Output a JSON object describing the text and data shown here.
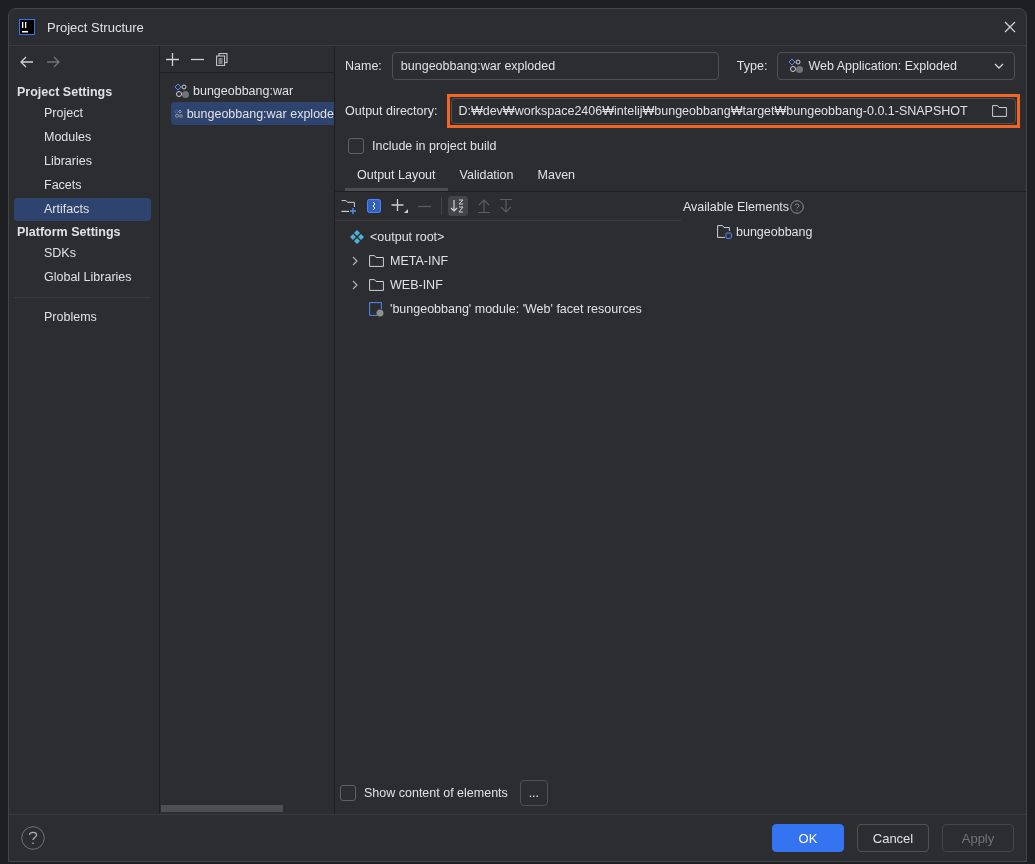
{
  "window": {
    "title": "Project Structure"
  },
  "nav": {
    "sections": [
      {
        "title": "Project Settings",
        "items": [
          {
            "label": "Project",
            "selected": false
          },
          {
            "label": "Modules",
            "selected": false
          },
          {
            "label": "Libraries",
            "selected": false
          },
          {
            "label": "Facets",
            "selected": false
          },
          {
            "label": "Artifacts",
            "selected": true
          }
        ]
      },
      {
        "title": "Platform Settings",
        "items": [
          {
            "label": "SDKs",
            "selected": false
          },
          {
            "label": "Global Libraries",
            "selected": false
          }
        ]
      }
    ],
    "extra_items": [
      {
        "label": "Problems",
        "selected": false
      }
    ]
  },
  "artifacts": [
    {
      "label": "bungeobbang:war",
      "selected": false
    },
    {
      "label": "bungeobbang:war explode",
      "selected": true
    }
  ],
  "name_field": {
    "label": "Name:",
    "value": "bungeobbang:war exploded"
  },
  "type_field": {
    "label": "Type:",
    "value": "Web Application: Exploded"
  },
  "output_directory": {
    "label": "Output directory:",
    "value": "D:₩dev₩workspace2406₩intelij₩bungeobbang₩target₩bungeobbang-0.0.1-SNAPSHOT"
  },
  "include_in_build": {
    "label": "Include in project build",
    "checked": false
  },
  "tabs": [
    {
      "label": "Output Layout",
      "selected": true
    },
    {
      "label": "Validation",
      "selected": false
    },
    {
      "label": "Maven",
      "selected": false
    }
  ],
  "layout_tree": [
    {
      "label": "<output root>",
      "kind": "root",
      "children": [
        {
          "label": "META-INF",
          "kind": "folder",
          "expanded": false
        },
        {
          "label": "WEB-INF",
          "kind": "folder",
          "expanded": false
        },
        {
          "label": "'bungeobbang' module: 'Web' facet resources",
          "kind": "resource"
        }
      ]
    }
  ],
  "available_elements": {
    "title": "Available Elements",
    "items": [
      {
        "label": "bungeobbang"
      }
    ]
  },
  "show_content": {
    "label": "Show content of elements",
    "checked": false
  },
  "more_button": "...",
  "buttons": [
    {
      "label": "OK",
      "kind": "primary"
    },
    {
      "label": "Cancel",
      "kind": "normal"
    },
    {
      "label": "Apply",
      "kind": "disabled"
    }
  ]
}
